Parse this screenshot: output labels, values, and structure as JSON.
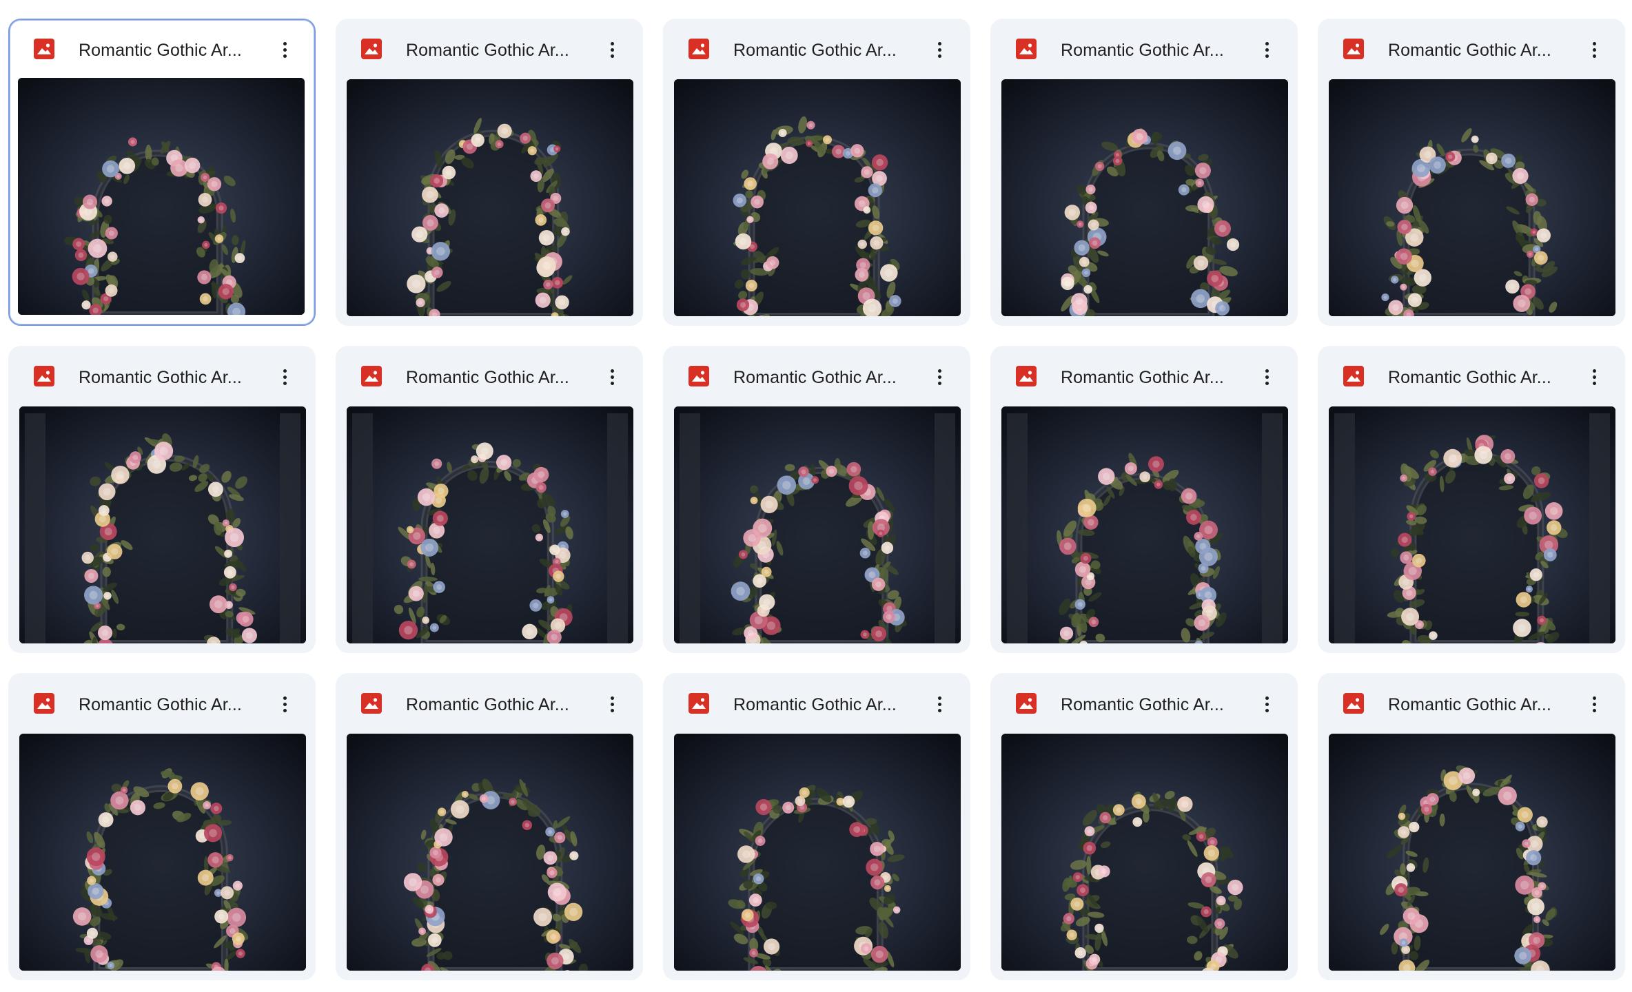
{
  "files": [
    {
      "name": "Romantic Gothic Ar...",
      "thumbnail": "gothic-arch-roses-1",
      "selected": true
    },
    {
      "name": "Romantic Gothic Ar...",
      "thumbnail": "gothic-arch-roses-2",
      "selected": false
    },
    {
      "name": "Romantic Gothic Ar...",
      "thumbnail": "gothic-arch-roses-3",
      "selected": false
    },
    {
      "name": "Romantic Gothic Ar...",
      "thumbnail": "gothic-arch-roses-4",
      "selected": false
    },
    {
      "name": "Romantic Gothic Ar...",
      "thumbnail": "gothic-arch-roses-5",
      "selected": false
    },
    {
      "name": "Romantic Gothic Ar...",
      "thumbnail": "gothic-arch-roses-6",
      "selected": false
    },
    {
      "name": "Romantic Gothic Ar...",
      "thumbnail": "gothic-arch-roses-7",
      "selected": false
    },
    {
      "name": "Romantic Gothic Ar...",
      "thumbnail": "gothic-arch-roses-8",
      "selected": false
    },
    {
      "name": "Romantic Gothic Ar...",
      "thumbnail": "gothic-arch-roses-9",
      "selected": false
    },
    {
      "name": "Romantic Gothic Ar...",
      "thumbnail": "gothic-arch-roses-10",
      "selected": false
    },
    {
      "name": "Romantic Gothic Ar...",
      "thumbnail": "gothic-arch-roses-11",
      "selected": false
    },
    {
      "name": "Romantic Gothic Ar...",
      "thumbnail": "gothic-arch-roses-12",
      "selected": false
    },
    {
      "name": "Romantic Gothic Ar...",
      "thumbnail": "gothic-arch-roses-13",
      "selected": false
    },
    {
      "name": "Romantic Gothic Ar...",
      "thumbnail": "gothic-arch-roses-14",
      "selected": false
    },
    {
      "name": "Romantic Gothic Ar...",
      "thumbnail": "gothic-arch-roses-15",
      "selected": false
    }
  ],
  "icons": {
    "file_type": "image-file-icon",
    "menu": "more-vert-icon"
  },
  "colors": {
    "image_file_icon": "#d93025",
    "card_background": "#f0f4f9",
    "selected_border": "#7a9be0",
    "title_text": "#1f1f1f"
  }
}
